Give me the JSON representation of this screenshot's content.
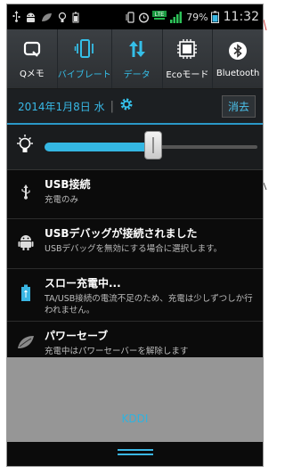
{
  "status_bar": {
    "lte_label": "LTE",
    "battery_percent": "79%",
    "time": "11:32"
  },
  "quick_toggles": [
    {
      "label": "Qメモ",
      "icon": "qmemo-icon",
      "state": "off"
    },
    {
      "label": "バイブレート",
      "icon": "vibrate-icon",
      "state": "on"
    },
    {
      "label": "データ",
      "icon": "data-icon",
      "state": "on"
    },
    {
      "label": "Ecoモード",
      "icon": "eco-mode-icon",
      "state": "off"
    },
    {
      "label": "Bluetooth",
      "icon": "bluetooth-icon",
      "state": "off"
    }
  ],
  "date_row": {
    "date": "2014年1月8日 水",
    "clear_label": "消去"
  },
  "brightness": {
    "level": 0.51
  },
  "notifications": [
    {
      "title": "USB接続",
      "subtitle": "充電のみ",
      "icon": "usb-icon"
    },
    {
      "title": "USBデバッグが接続されました",
      "subtitle": "USBデバッグを無効にする場合に選択します。",
      "icon": "android-debug-icon"
    },
    {
      "title": "スロー充電中...",
      "subtitle": "TA/USB接続の電流不足のため、充電は少しずつしか行われません。",
      "icon": "battery-charging-icon"
    },
    {
      "title": "パワーセーブ",
      "subtitle": "充電中はパワーセーバーを解除します",
      "icon": "leaf-icon"
    }
  ],
  "carrier": "KDDI",
  "colors": {
    "accent": "#35bfe8",
    "background": "#0b0b0b",
    "carrier_area": "#969696"
  }
}
